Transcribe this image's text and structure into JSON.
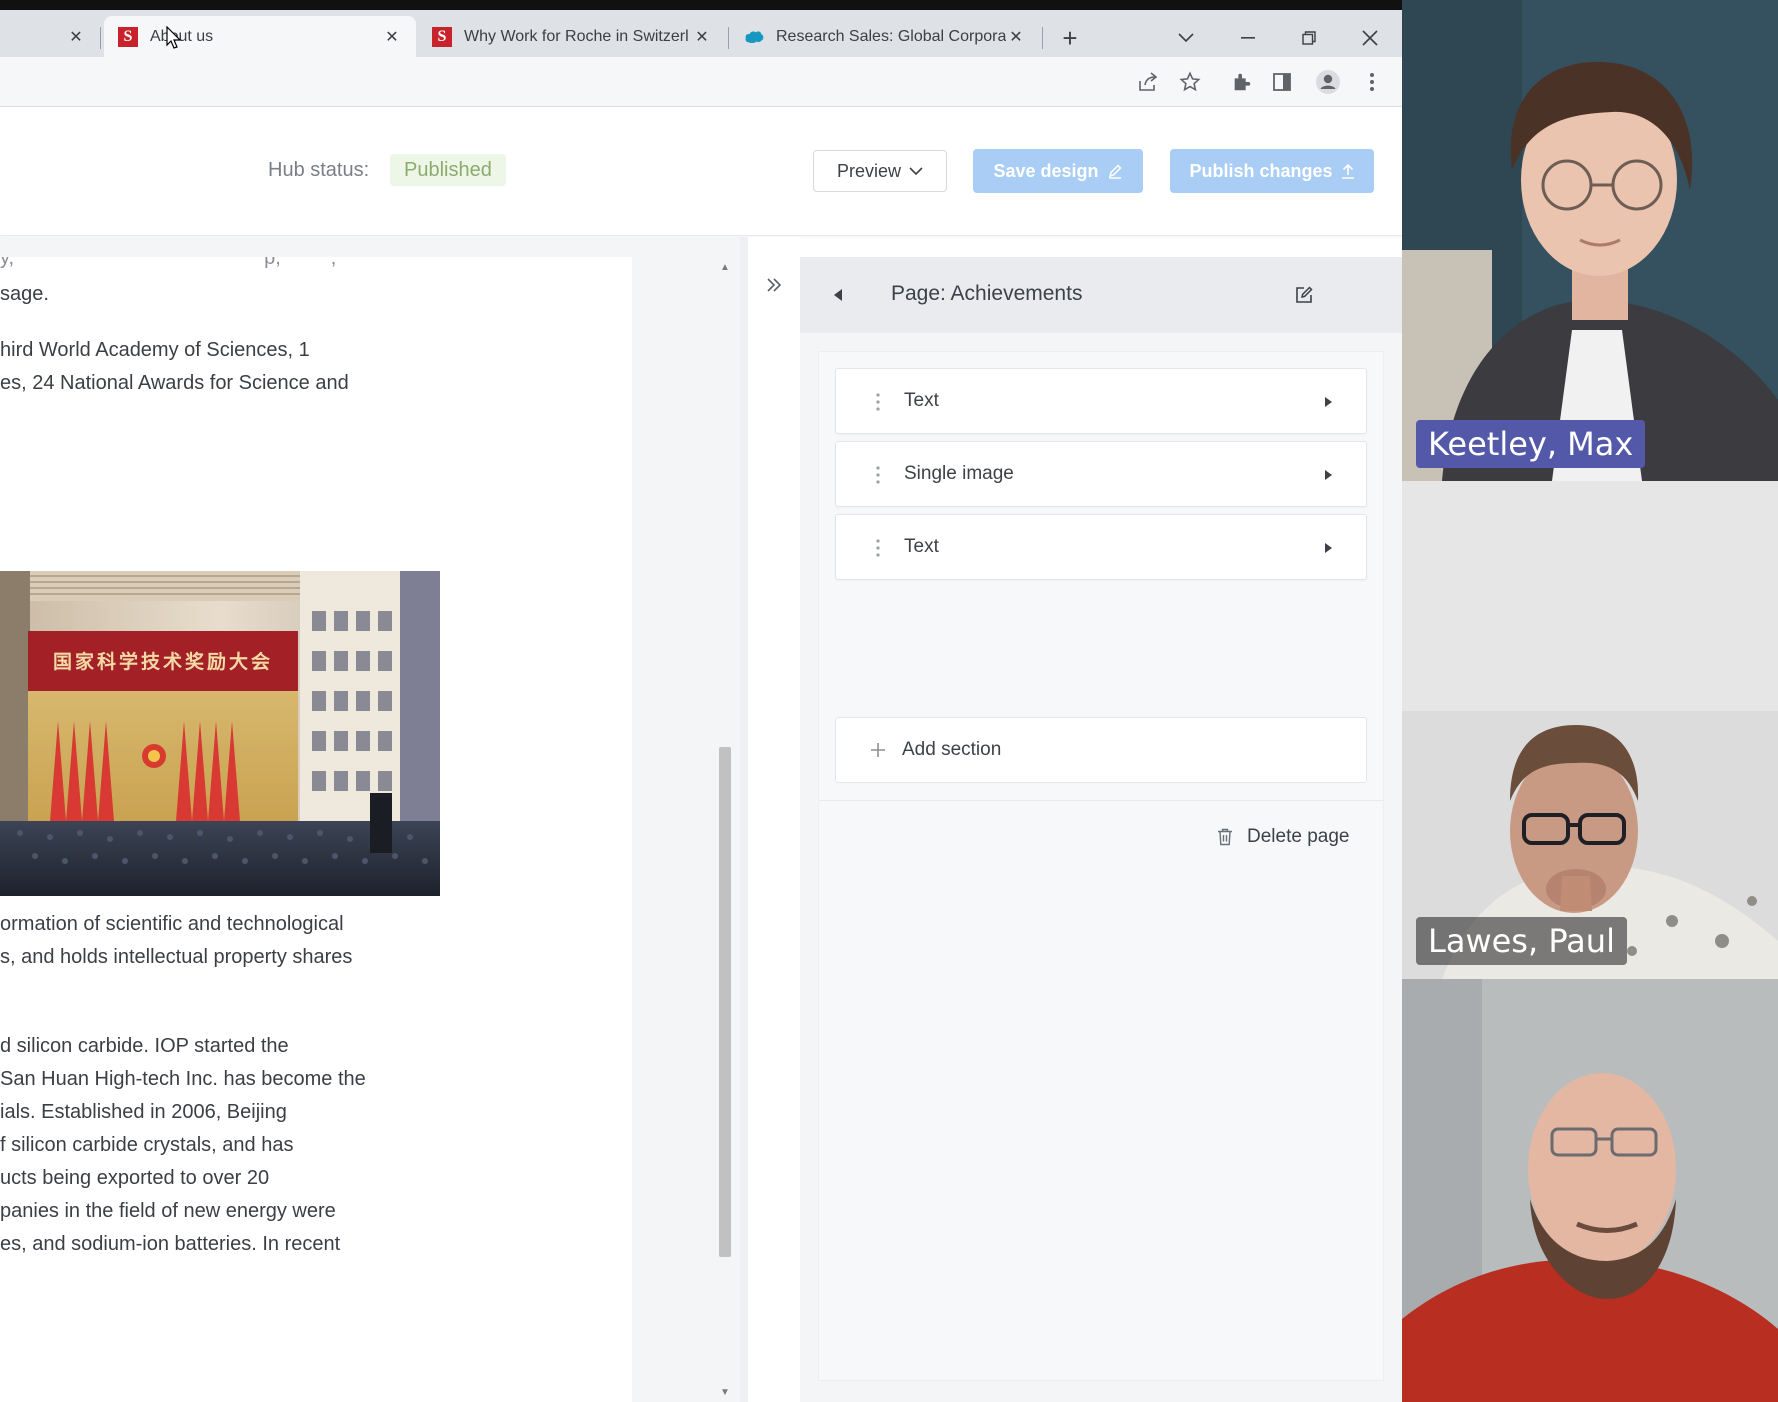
{
  "browser": {
    "tabs": [
      {
        "title": "",
        "favicon": "",
        "active": false
      },
      {
        "title": "About us",
        "favicon": "S",
        "active": true
      },
      {
        "title": "Why Work for Roche in Switzerl",
        "favicon": "S",
        "active": false
      },
      {
        "title": "Research Sales: Global Corporat",
        "favicon": "salesforce-cloud",
        "active": false
      }
    ],
    "close_glyph": "✕",
    "new_tab_glyph": "+",
    "tab_list_glyph": "⌄",
    "minimize_glyph": "—",
    "restore_glyph": "❐",
    "window_close_glyph": "✕",
    "toolbar_icons": [
      "share-icon",
      "star-icon",
      "extensions-icon",
      "side-panel-icon",
      "profile-icon",
      "more-vert-icon"
    ]
  },
  "header": {
    "hub_status_label": "Hub status:",
    "hub_status_value": "Published",
    "preview_label": "Preview",
    "save_design_label": "Save design",
    "publish_label": "Publish changes",
    "colors": {
      "primary_disabled": "#a9cdf5",
      "published_bg": "#eef6e7",
      "published_text": "#8cab6e"
    }
  },
  "content": {
    "lines_top": [
      "sage.",
      "hird World Academy of Sciences, 1",
      "es, 24 National Awards for Science and"
    ],
    "image_banner_text": "国家科学技术奖励大会",
    "lines_mid": [
      "ormation of scientific and technological",
      "s, and holds intellectual property shares"
    ],
    "lines_bottom": [
      "d silicon carbide. IOP started the",
      "San Huan High-tech Inc. has become the",
      "ials. Established in 2006, Beijing",
      "f silicon carbide crystals, and has",
      "ucts being exported to over 20",
      "panies in the field of new energy were",
      "es, and sodium-ion batteries. In recent"
    ]
  },
  "side_panel": {
    "title": "Page: Achievements",
    "sections": [
      {
        "label": "Text"
      },
      {
        "label": "Single image"
      },
      {
        "label": "Text"
      }
    ],
    "add_section_label": "Add section",
    "delete_page_label": "Delete page"
  },
  "participants": [
    {
      "name": "Keetley, Max",
      "speaking": true
    },
    {
      "name": "Lawes, Paul",
      "speaking": false
    },
    {
      "name": "",
      "speaking": false
    }
  ]
}
